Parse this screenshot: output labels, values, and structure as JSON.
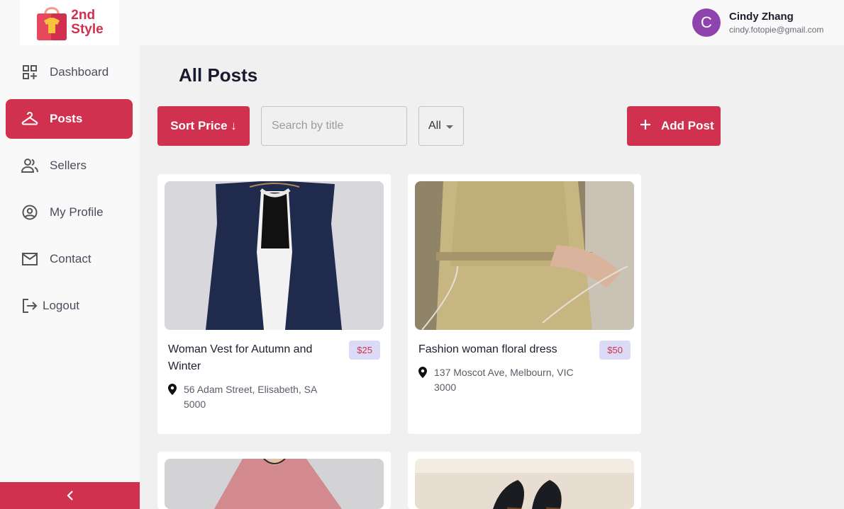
{
  "brand": {
    "line1": "2nd",
    "line2": "Style"
  },
  "user": {
    "initial": "C",
    "name": "Cindy Zhang",
    "email": "cindy.fotopie@gmail.com"
  },
  "nav": [
    {
      "label": "Dashboard",
      "icon": "dashboard-icon"
    },
    {
      "label": "Posts",
      "icon": "hanger-icon",
      "active": true
    },
    {
      "label": "Sellers",
      "icon": "people-icon"
    },
    {
      "label": "My Profile",
      "icon": "account-circle-icon"
    },
    {
      "label": "Contact",
      "icon": "mail-icon"
    },
    {
      "label": "Logout",
      "icon": "logout-icon"
    }
  ],
  "page": {
    "title": "All Posts",
    "sort_label": "Sort Price ↓",
    "search_placeholder": "Search by title",
    "filter_value": "All",
    "add_label": "Add Post"
  },
  "posts": [
    {
      "title": "Woman Vest for Autumn and Winter",
      "price": "$25",
      "address": "56 Adam Street, Elisabeth, SA 5000"
    },
    {
      "title": "Fashion woman floral dress",
      "price": "$50",
      "address": "137 Moscot Ave, Melbourn, VIC 3000"
    }
  ],
  "colors": {
    "accent": "#cf314f",
    "avatar": "#8e44ad",
    "price_bg": "#dcdbf7"
  }
}
